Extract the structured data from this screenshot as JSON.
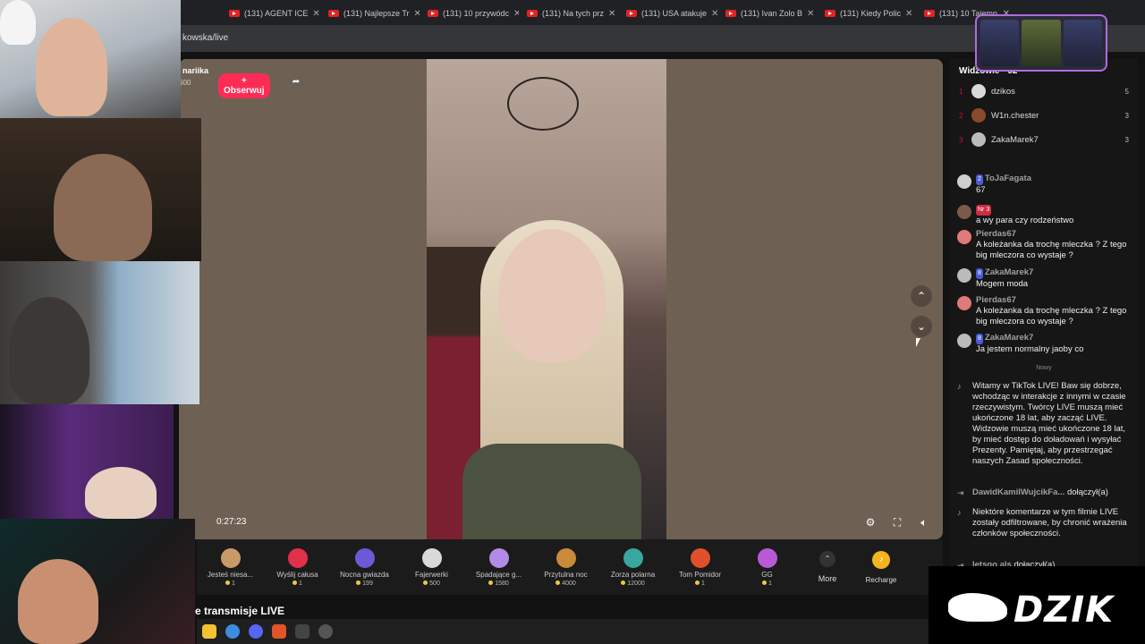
{
  "browser": {
    "tabs": [
      {
        "title": "(131) AGENT ICE"
      },
      {
        "title": "(131) Najlepsze Tr"
      },
      {
        "title": "(131) 10 przywódc"
      },
      {
        "title": "(131) Na tych prz"
      },
      {
        "title": "(131) USA atakuje"
      },
      {
        "title": "(131) Ivan Zolo B"
      },
      {
        "title": "(131) Kiedy Polic"
      },
      {
        "title": "(131) 10 Tajemn"
      }
    ],
    "url": "kowska/live"
  },
  "live": {
    "host_name": "nariika",
    "host_count": "600",
    "follow_label": "+ Obserwuj",
    "timer": "0:27:23",
    "bottom_title": "e transmisje LIVE"
  },
  "gifts": [
    {
      "name": "Jesteś niesa...",
      "price": "1",
      "color": "#c89a6a"
    },
    {
      "name": "Wyślij całusa",
      "price": "1",
      "color": "#e0304a"
    },
    {
      "name": "Nocna gwiazda",
      "price": "199",
      "color": "#6a5ad6"
    },
    {
      "name": "Fajerwerki",
      "price": "500",
      "color": "#d9d9d9"
    },
    {
      "name": "Spadające g...",
      "price": "1580",
      "color": "#b28be8"
    },
    {
      "name": "Przytulna noc",
      "price": "4000",
      "color": "#c98a3a"
    },
    {
      "name": "Zorza polarna",
      "price": "12000",
      "color": "#3aa6a0"
    },
    {
      "name": "Tom Pomidor",
      "price": "1",
      "color": "#e0502a"
    },
    {
      "name": "GG",
      "price": "1",
      "color": "#b85ad6"
    }
  ],
  "more_label": "More",
  "recharge_label": "Recharge",
  "panel": {
    "viewers_header": "Widzowie · 92",
    "top_viewers": [
      {
        "rank": "1",
        "name": "dzikos",
        "score": "5",
        "color": "#d9d9d9"
      },
      {
        "rank": "2",
        "name": "W1n.chester",
        "score": "3",
        "color": "#8a4a2a"
      },
      {
        "rank": "3",
        "name": "ZakaMarek7",
        "score": "3",
        "color": "#bbbbbb"
      }
    ],
    "chat": [
      {
        "badge": "2",
        "user": "ToJaFagata",
        "text": "67",
        "color": "#cfcfcf"
      },
      {
        "badge": "Nr 3",
        "user": "",
        "text": "a wy para czy rodzeństwo",
        "color": "#7a5a4a"
      },
      {
        "badge": "",
        "user": "Pierdas67",
        "text": "A koleżanka da trochę mleczka ? Z tego big mleczora co wystaje ?",
        "color": "#e07a7a"
      },
      {
        "badge": "8",
        "user": "ZakaMarek7",
        "text": "Mogem moda",
        "color": "#bbbbbb"
      },
      {
        "badge": "",
        "user": "Pierdas67",
        "text": "A koleżanka da trochę mleczka ? Z tego big mleczora co wystaje ?",
        "color": "#e07a7a"
      },
      {
        "badge": "8",
        "user": "ZakaMarek7",
        "text": "Ja jestem normalny jaoby co",
        "color": "#bbbbbb"
      }
    ],
    "new_divider": "Nowy",
    "system_welcome": "Witamy w TikTok LIVE! Baw się dobrze, wchodząc w interakcje z innymi w czasie rzeczywistym. Twórcy LIVE muszą mieć ukończone 18 lat, aby zacząć LIVE. Widzowie muszą mieć ukończone 18 lat, by mieć dostęp do doładowań i wysyłać Prezenty. Pamiętaj, aby przestrzegać naszych Zasad społeczności.",
    "join1_user": "DawidKamilWujcikFa...",
    "join1_text": "dołączył(a)",
    "system_filter": "Niektóre komentarze w tym filmie LIVE zostały odfiltrowane, by chronić wrażenia członków społeczności.",
    "join2_user": "letsgo als",
    "join2_text": "dołączył(a)"
  },
  "overlay": {
    "brand": "DZIK"
  }
}
